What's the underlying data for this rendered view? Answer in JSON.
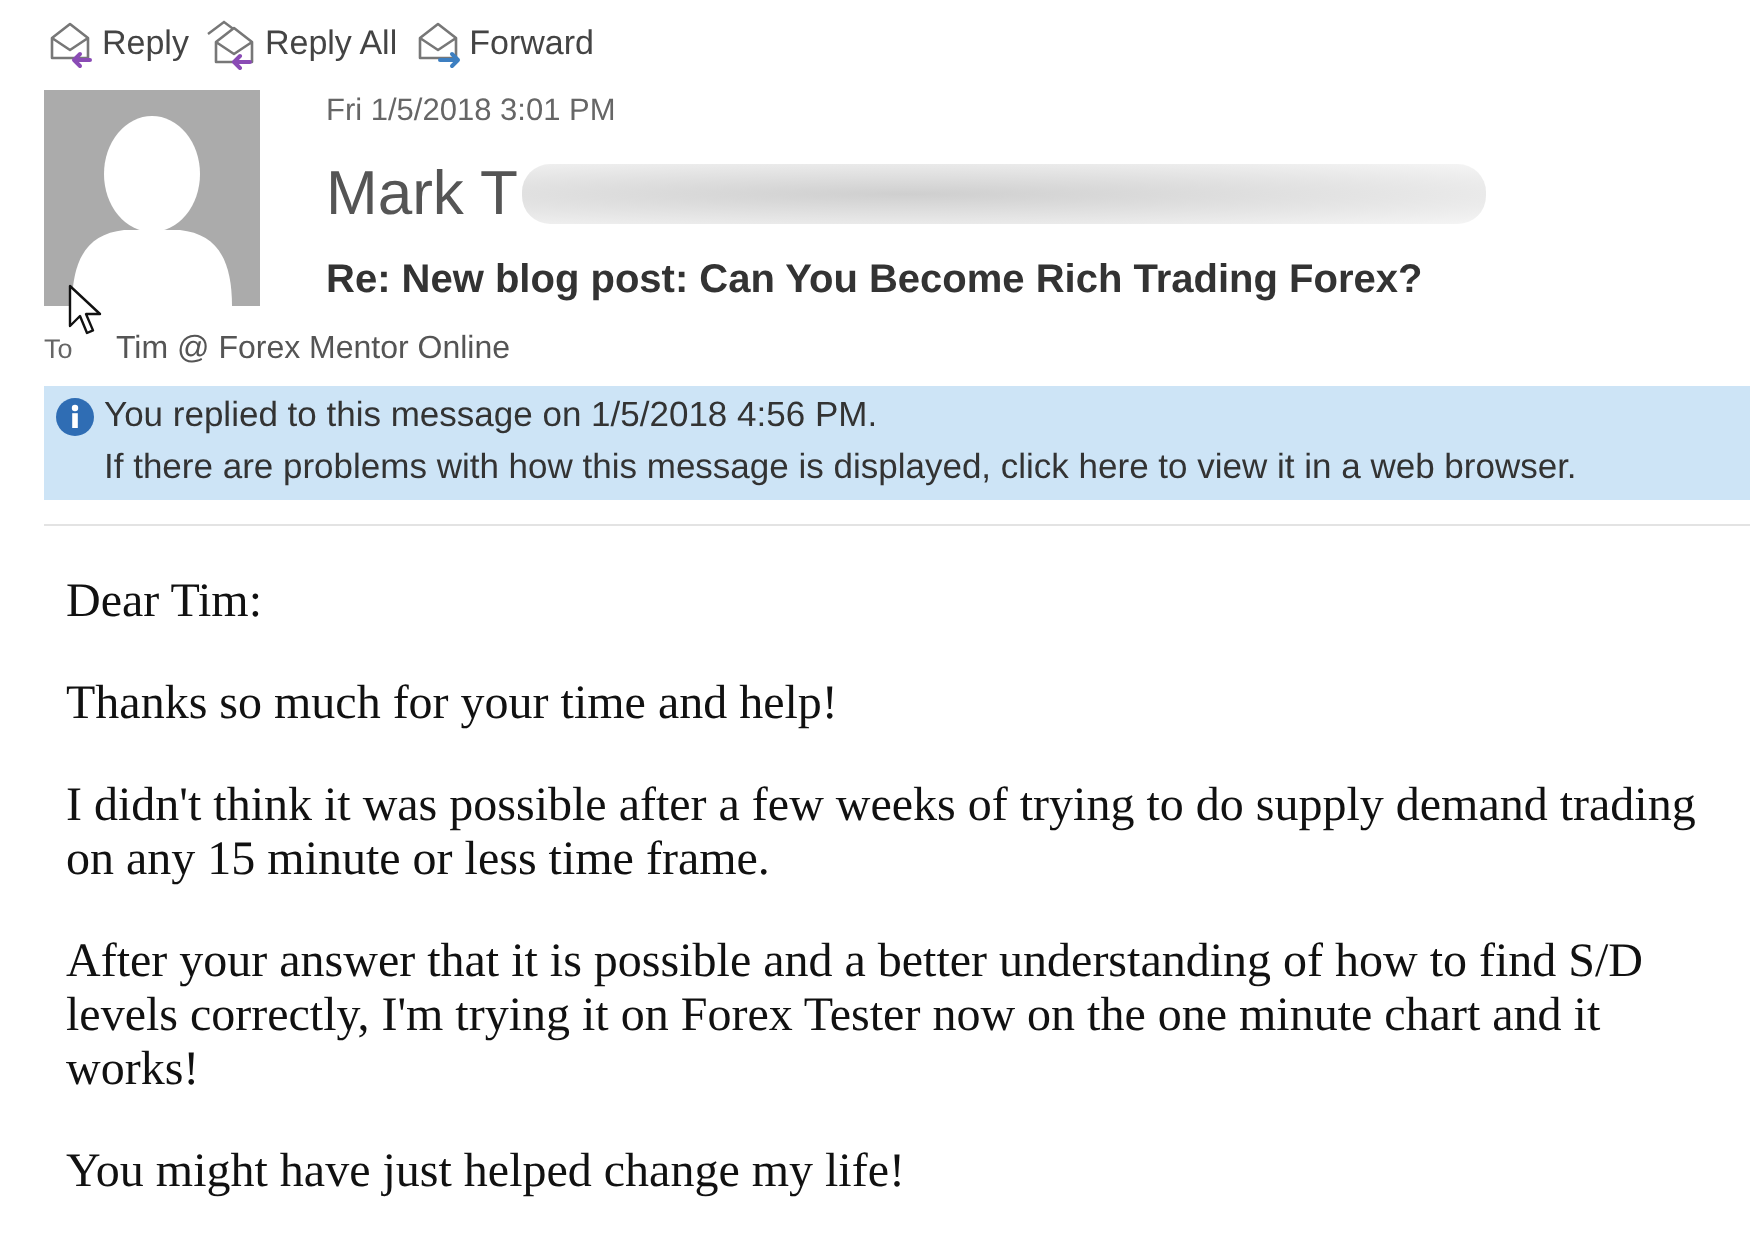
{
  "toolbar": [
    {
      "kind": "reply",
      "label": "Reply"
    },
    {
      "kind": "reply_all",
      "label": "Reply All"
    },
    {
      "kind": "forward",
      "label": "Forward"
    }
  ],
  "header": {
    "date": "Fri 1/5/2018 3:01 PM",
    "sender": "Mark T",
    "subject": "Re: New blog post: Can You Become Rich Trading Forex?",
    "to_label": "To",
    "recipient": "Tim @ Forex Mentor Online"
  },
  "info_bar": {
    "lines": [
      "You replied to this message on 1/5/2018 4:56 PM.",
      "If there are problems with how this message is displayed, click here to view it in a web browser."
    ]
  },
  "body": {
    "paragraphs": [
      "Dear Tim:",
      "Thanks so much for your time and help!",
      "I didn't think it was possible after a few weeks of trying to do supply demand trading on any 15 minute or less time frame.",
      "After your answer that it is possible and a better understanding of how to find S/D levels correctly, I'm trying it on Forex Tester now on the one minute chart and it works!",
      "You might have just helped change my life!"
    ]
  }
}
